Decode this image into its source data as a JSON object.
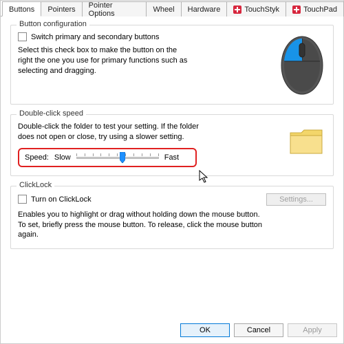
{
  "tabs": {
    "items": [
      {
        "label": "Buttons",
        "active": true
      },
      {
        "label": "Pointers"
      },
      {
        "label": "Pointer Options"
      },
      {
        "label": "Wheel"
      },
      {
        "label": "Hardware"
      },
      {
        "label": "TouchStyk",
        "icon": true
      },
      {
        "label": "TouchPad",
        "icon": true
      }
    ]
  },
  "button_config": {
    "legend": "Button configuration",
    "checkbox_label": "Switch primary and secondary buttons",
    "checked": false,
    "description": "Select this check box to make the button on the right the one you use for primary functions such as selecting and dragging."
  },
  "double_click": {
    "legend": "Double-click speed",
    "description": "Double-click the folder to test your setting. If the folder does not open or close, try using a slower setting.",
    "speed_label": "Speed:",
    "slow_label": "Slow",
    "fast_label": "Fast",
    "value_percent": 56
  },
  "click_lock": {
    "legend": "ClickLock",
    "checkbox_label": "Turn on ClickLock",
    "checked": false,
    "settings_button": "Settings...",
    "settings_enabled": false,
    "description": "Enables you to highlight or drag without holding down the mouse button. To set, briefly press the mouse button. To release, click the mouse button again."
  },
  "footer": {
    "ok": "OK",
    "cancel": "Cancel",
    "apply": "Apply"
  },
  "colors": {
    "highlight_red": "#e02020",
    "primary_blue": "#0078d7",
    "icon_red": "#d7263d"
  }
}
